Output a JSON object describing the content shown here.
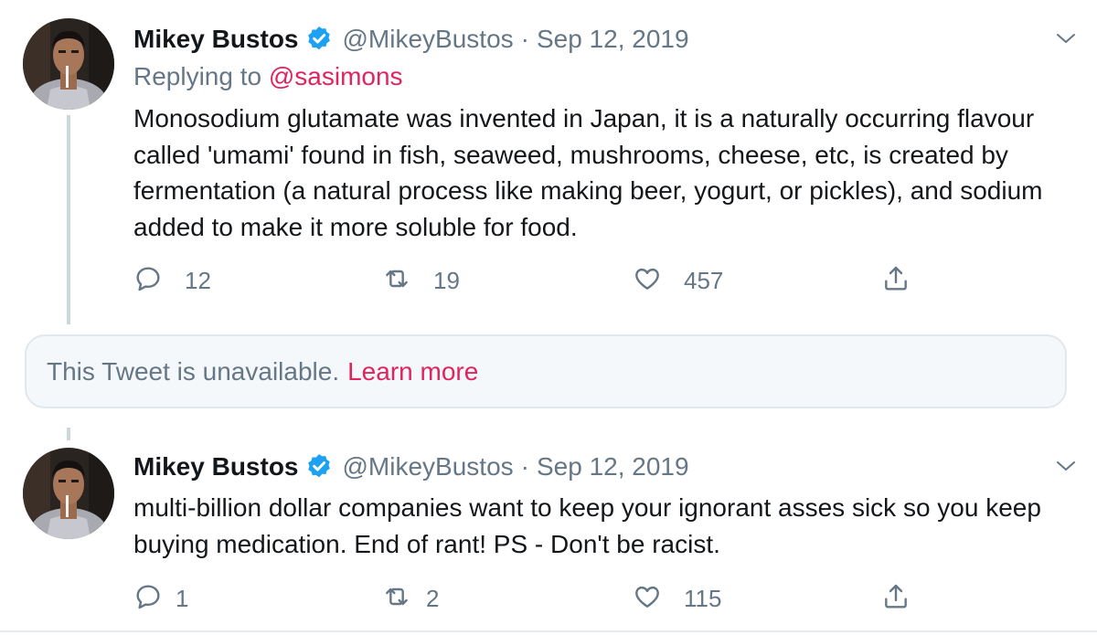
{
  "colors": {
    "accent_pink": "#e0245e",
    "verified_blue": "#1da1f2",
    "secondary_text": "#657786",
    "primary_text": "#14171a"
  },
  "tweets": [
    {
      "author_name": "Mikey Bustos",
      "handle": "@MikeyBustos",
      "separator": "·",
      "date": "Sep 12, 2019",
      "verified": true,
      "replying_prefix": "Replying to",
      "replying_to": "@sasimons",
      "text": "Monosodium glutamate was invented in Japan, it is a naturally occurring flavour called 'umami' found in fish, seaweed, mushrooms, cheese, etc, is created by fermentation (a natural process like making beer, yogurt, or pickles), and sodium added to make it more soluble for food.",
      "replies": "12",
      "retweets": "19",
      "likes": "457",
      "icons": [
        "reply-icon",
        "retweet-icon",
        "like-icon",
        "share-icon",
        "caret-down-icon",
        "verified-badge-icon"
      ]
    },
    {
      "author_name": "Mikey Bustos",
      "handle": "@MikeyBustos",
      "separator": "·",
      "date": "Sep 12, 2019",
      "verified": true,
      "text": "multi-billion dollar companies want to keep your ignorant asses sick so you keep buying medication. End of rant! PS - Don't be racist.",
      "replies": "1",
      "retweets": "2",
      "likes": "115",
      "icons": [
        "reply-icon",
        "retweet-icon",
        "like-icon",
        "share-icon",
        "caret-down-icon",
        "verified-badge-icon"
      ]
    }
  ],
  "unavailable_notice": {
    "text": "This Tweet is unavailable.",
    "link": "Learn more"
  }
}
